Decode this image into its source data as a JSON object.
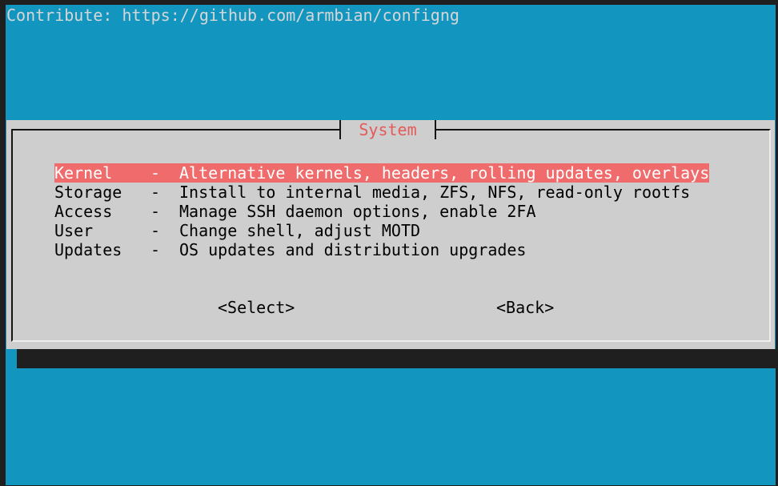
{
  "backtitle": "Contribute: https://github.com/armbian/configng",
  "dialog": {
    "title": "System",
    "menu": [
      {
        "name": "Kernel",
        "sep": "-",
        "desc": "Alternative kernels, headers, rolling updates, overlays",
        "selected": true
      },
      {
        "name": "Storage",
        "sep": "-",
        "desc": "Install to internal media, ZFS, NFS, read-only rootfs",
        "selected": false
      },
      {
        "name": "Access",
        "sep": "-",
        "desc": "Manage SSH daemon options, enable 2FA",
        "selected": false
      },
      {
        "name": "User",
        "sep": "-",
        "desc": "Change shell, adjust MOTD",
        "selected": false
      },
      {
        "name": "Updates",
        "sep": "-",
        "desc": "OS updates and distribution upgrades",
        "selected": false
      }
    ],
    "buttons": {
      "select": "<Select>",
      "back": "<Back>"
    }
  },
  "colors": {
    "background": "#1296bf",
    "dialog": "#cecece",
    "highlight": "#f06b6b",
    "title": "#e35a5a"
  }
}
